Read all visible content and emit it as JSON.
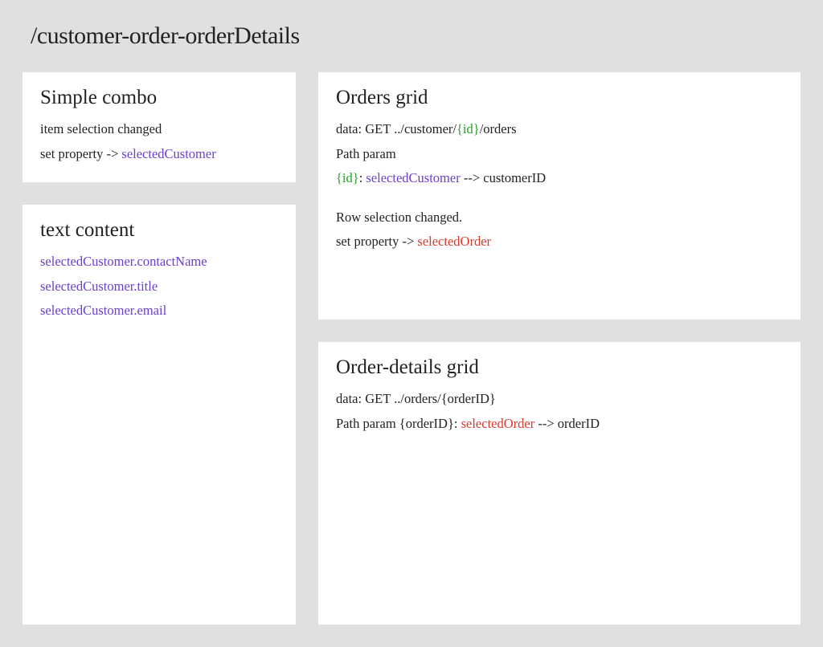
{
  "page": {
    "title": "/customer-order-orderDetails"
  },
  "simpleCombo": {
    "heading": "Simple combo",
    "line1_text": "item selection changed",
    "line2_prefix": "set property -> ",
    "line2_purple": "selectedCustomer"
  },
  "textContent": {
    "heading": "text content",
    "lines": [
      "selectedCustomer.contactName",
      "selectedCustomer.title",
      "selectedCustomer.email"
    ]
  },
  "ordersGrid": {
    "heading": "Orders grid",
    "dataLabel": "data:  ",
    "dataMethodPrefix": "GET ../customer/",
    "dataIdToken": "{id}",
    "dataSuffix": "/orders",
    "pathParamLabel": "Path  param",
    "pp_id": "{id}",
    "pp_sep1": ": ",
    "pp_purple": "selectedCustomer",
    "pp_arrow": " --> customerID",
    "rowSelLine": "Row selection changed.",
    "setPropPrefix": "set property -> ",
    "setPropRed": "selectedOrder"
  },
  "orderDetailsGrid": {
    "heading": "Order-details grid",
    "dataLabel": "data:  ",
    "dataMethod": "GET ../orders/{orderID}",
    "pp_prefix": "Path param {orderID}: ",
    "pp_red": "selectedOrder",
    "pp_arrow": " --> orderID"
  }
}
